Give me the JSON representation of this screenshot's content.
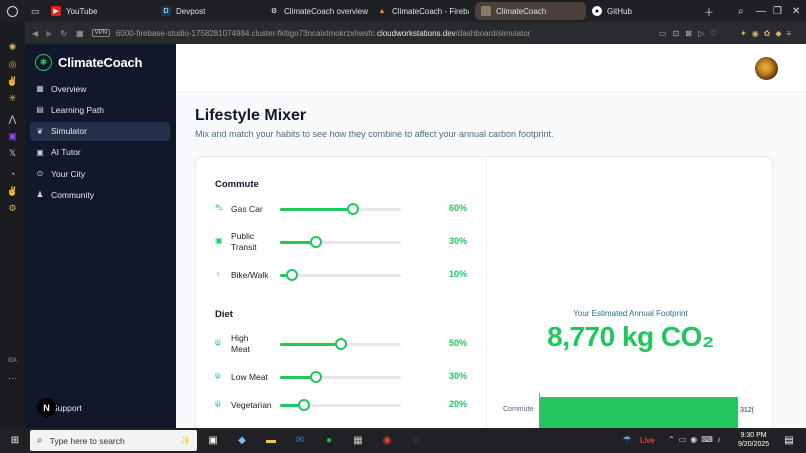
{
  "browser": {
    "tabs": [
      {
        "label": "YouTube",
        "icon": "youtube-icon"
      },
      {
        "label": "Devpost",
        "icon": "devpost-icon"
      },
      {
        "label": "ClimateCoach overview",
        "icon": "gear-icon"
      },
      {
        "label": "ClimateCoach - Firebase",
        "icon": "firebase-icon"
      },
      {
        "label": "ClimateCoach",
        "icon": "project-icon"
      },
      {
        "label": "GitHub",
        "icon": "github-icon"
      }
    ],
    "vpn_label": "VPN",
    "url_prefix": "6000-firebase-studio-1758281074984.cluster-fkltigo73ncaixtmokrzxhwsfc.",
    "url_domain": "cloudworkstations.dev",
    "url_path": "/dashboard/simulator"
  },
  "sidebar": {
    "brand": "ClimateCoach",
    "items": [
      {
        "label": "Overview",
        "icon": "grid-icon"
      },
      {
        "label": "Learning Path",
        "icon": "book-icon"
      },
      {
        "label": "Simulator",
        "icon": "leaf-icon",
        "active": true
      },
      {
        "label": "AI Tutor",
        "icon": "bot-icon"
      },
      {
        "label": "Your City",
        "icon": "pin-icon"
      },
      {
        "label": "Community",
        "icon": "users-icon"
      }
    ],
    "support_label": "Support",
    "support_badge": "N"
  },
  "page": {
    "title": "Lifestyle Mixer",
    "subtitle": "Mix and match your habits to see how they combine to affect your annual carbon footprint."
  },
  "sections": [
    {
      "title": "Commute",
      "rows": [
        {
          "label": "Gas Car",
          "label2": "",
          "icon": "car-icon",
          "value": 60,
          "display": "60%"
        },
        {
          "label": "Public",
          "label2": "Transit",
          "icon": "train-icon",
          "value": 30,
          "display": "30%"
        },
        {
          "label": "Bike/Walk",
          "label2": "",
          "icon": "bike-icon",
          "value": 10,
          "display": "10%"
        }
      ]
    },
    {
      "title": "Diet",
      "rows": [
        {
          "label": "High",
          "label2": "Meat",
          "icon": "utensils-icon",
          "value": 50,
          "display": "50%"
        },
        {
          "label": "Low Meat",
          "label2": "",
          "icon": "utensils-icon",
          "value": 30,
          "display": "30%"
        },
        {
          "label": "Vegetarian",
          "label2": "",
          "icon": "utensils-icon",
          "value": 20,
          "display": "20%"
        }
      ]
    }
  ],
  "footprint": {
    "label": "Your Estimated Annual Footprint",
    "value": "8,770 kg CO₂"
  },
  "breakdown": {
    "category": "Commute",
    "value_label": "312(",
    "fill_fraction": 1.0
  },
  "taskbar": {
    "search_placeholder": "Type here to search",
    "live_label": "Live",
    "time": "9:30 PM",
    "date": "9/20/2025"
  },
  "colors": {
    "accent": "#22c55e",
    "sidebar_bg": "#12182b",
    "sidebar_active": "#243049"
  }
}
